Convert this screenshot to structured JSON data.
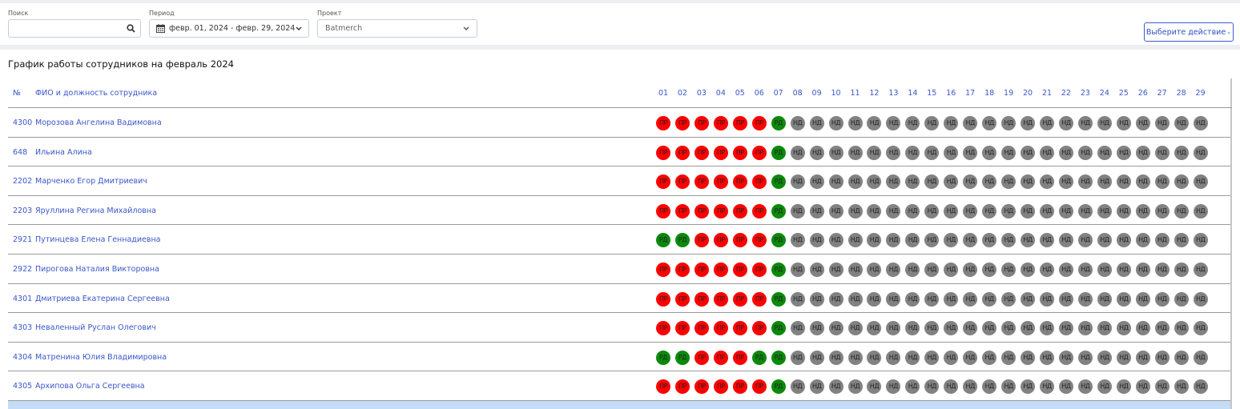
{
  "filters": {
    "search": {
      "label": "Поиск",
      "value": "",
      "icon": "search-icon"
    },
    "period": {
      "label": "Период",
      "value": "февр. 01, 2024 - февр. 29, 2024",
      "icon": "calendar-icon"
    },
    "project": {
      "label": "Проект",
      "value": "Batmerch"
    },
    "action_button": "Выберите действие"
  },
  "heading": "График работы сотрудников на февраль 2024",
  "table": {
    "col_no": "№",
    "col_name": "ФИО и должность сотрудника",
    "days": [
      "01",
      "02",
      "03",
      "04",
      "05",
      "06",
      "07",
      "08",
      "09",
      "10",
      "11",
      "12",
      "13",
      "14",
      "15",
      "16",
      "17",
      "18",
      "19",
      "20",
      "21",
      "22",
      "23",
      "24",
      "25",
      "26",
      "27",
      "28",
      "29"
    ],
    "status_labels": {
      "pr": "ПР",
      "rd": "РД",
      "nd": "НД"
    },
    "status_colors": {
      "pr": "#ff0000",
      "rd": "#0a8a0a",
      "nd": "#828282"
    },
    "rows": [
      {
        "id": "4300",
        "name": "Морозова Ангелина Вадимовна",
        "first_week": [
          "pr",
          "pr",
          "pr",
          "pr",
          "pr",
          "pr",
          "rd"
        ]
      },
      {
        "id": "648",
        "name": "Ильина Алина",
        "first_week": [
          "pr",
          "pr",
          "pr",
          "pr",
          "pr",
          "pr",
          "rd"
        ]
      },
      {
        "id": "2202",
        "name": "Марченко Егор Дмитриевич",
        "first_week": [
          "pr",
          "pr",
          "pr",
          "pr",
          "pr",
          "pr",
          "rd"
        ]
      },
      {
        "id": "2203",
        "name": "Яруллина Регина Михайловна",
        "first_week": [
          "pr",
          "pr",
          "pr",
          "pr",
          "pr",
          "pr",
          "rd"
        ]
      },
      {
        "id": "2921",
        "name": "Путинцева Елена Геннадиевна",
        "first_week": [
          "rd",
          "rd",
          "pr",
          "pr",
          "pr",
          "pr",
          "rd"
        ]
      },
      {
        "id": "2922",
        "name": "Пирогова Наталия Викторовна",
        "first_week": [
          "pr",
          "pr",
          "pr",
          "pr",
          "pr",
          "pr",
          "rd"
        ]
      },
      {
        "id": "4301",
        "name": "Дмитриева Екатерина Сергеевна",
        "first_week": [
          "pr",
          "pr",
          "pr",
          "pr",
          "pr",
          "pr",
          "rd"
        ]
      },
      {
        "id": "4303",
        "name": "Неваленный Руслан Олегович",
        "first_week": [
          "pr",
          "pr",
          "pr",
          "pr",
          "pr",
          "pr",
          "rd"
        ]
      },
      {
        "id": "4304",
        "name": "Матренина Юлия Владимировна",
        "first_week": [
          "rd",
          "rd",
          "pr",
          "pr",
          "pr",
          "rd",
          "rd"
        ]
      },
      {
        "id": "4305",
        "name": "Архипова Ольга Сергеевна",
        "first_week": [
          "pr",
          "pr",
          "pr",
          "pr",
          "pr",
          "pr",
          "rd"
        ]
      }
    ],
    "rest_status": "nd"
  }
}
